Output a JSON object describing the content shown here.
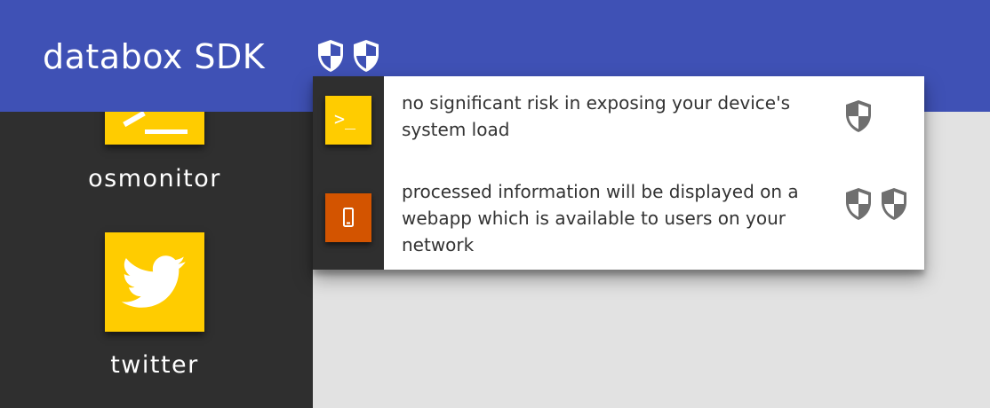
{
  "app": {
    "title": "databox SDK",
    "risk_level_shields": 2,
    "colors": {
      "header": "#3f51b5",
      "sidebar": "#2f2f2f",
      "tile": "#ffcc00",
      "high_risk": "#d35400",
      "content_bg": "#e2e2e2"
    }
  },
  "header": {
    "shields": [
      {
        "icon": "half-shield-icon"
      },
      {
        "icon": "half-shield-icon"
      }
    ]
  },
  "sidebar": {
    "apps": [
      {
        "label": "osmonitor",
        "icon": "terminal-icon"
      },
      {
        "label": "twitter",
        "icon": "twitter-bird-icon"
      }
    ]
  },
  "risk_popup": {
    "items": [
      {
        "icon": "terminal-icon",
        "icon_text": ">_",
        "description": "no significant risk in exposing your device's system load",
        "shield_count": 1
      },
      {
        "icon": "phone-icon",
        "description": "processed information will be displayed on a webapp which is available to users on your network",
        "shield_count": 2
      }
    ]
  }
}
